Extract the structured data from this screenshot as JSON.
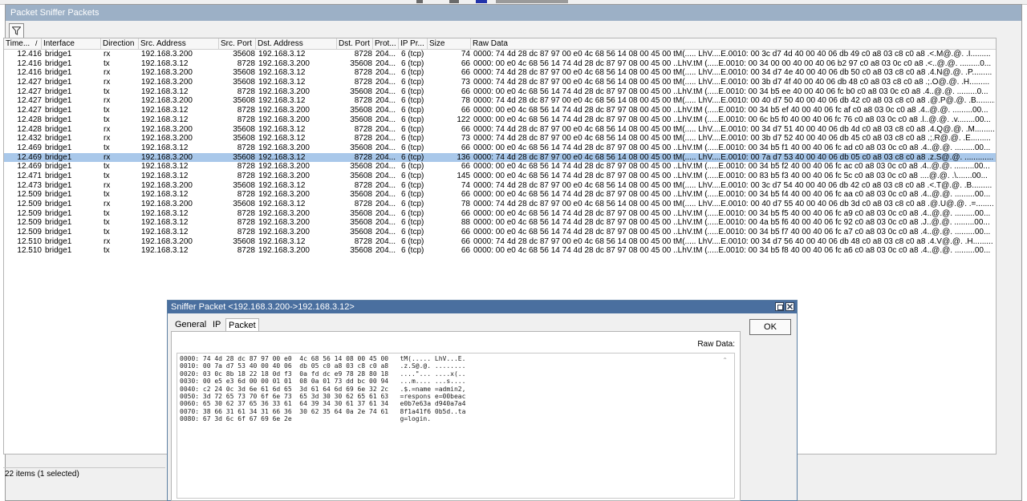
{
  "window": {
    "title": "Packet Sniffer Packets"
  },
  "toolbar": {
    "filter_icon": "funnel-icon"
  },
  "columns": [
    "Time...",
    "/",
    "Interface",
    "Direction",
    "Src. Address",
    "Src. Port",
    "Dst. Address",
    "Dst. Port",
    "Prot...",
    "IP Pr...",
    "Size",
    "Raw Data"
  ],
  "rows": [
    [
      "12.416",
      "bridge1",
      "rx",
      "192.168.3.200",
      "35608",
      "192.168.3.12",
      "8728",
      "204...",
      "6 (tcp)",
      "74",
      "0000: 74 4d 28 dc 87 97 00 e0  4c 68 56 14 08 00 45 00  tM(..... LhV....E.0010: 00 3c d7 4d 40 00 40 06  db 49 c0 a8 03 c8 c0 a8  .<.M@.@. .I.........",
      false
    ],
    [
      "12.416",
      "bridge1",
      "tx",
      "192.168.3.12",
      "8728",
      "192.168.3.200",
      "35608",
      "204...",
      "6 (tcp)",
      "66",
      "0000: 00 e0 4c 68 56 14 74 4d  28 dc 87 97 08 00 45 00  ..LhV.tM (.....E.0010: 00 34 00 00 40 00 40 06  b2 97 c0 a8 03 0c c0 a8  .<..@.@. .........0...",
      false
    ],
    [
      "12.416",
      "bridge1",
      "rx",
      "192.168.3.200",
      "35608",
      "192.168.3.12",
      "8728",
      "204...",
      "6 (tcp)",
      "66",
      "0000: 74 4d 28 dc 87 97 00 e0  4c 68 56 14 08 00 45 00  tM(..... LhV....E.0010: 00 34 d7 4e 40 00 40 06  db 50 c0 a8 03 c8 c0 a8  .4.N@.@. .P.........",
      false
    ],
    [
      "12.427",
      "bridge1",
      "rx",
      "192.168.3.200",
      "35608",
      "192.168.3.12",
      "8728",
      "204...",
      "6 (tcp)",
      "73",
      "0000: 74 4d 28 dc 87 97 00 e0  4c 68 56 14 08 00 45 00  tM(..... LhV....E.0010: 00 3b d7 4f 40 00 40 06  db 48 c0 a8 03 c8 c0 a8  .;.O@.@. .H.........",
      false
    ],
    [
      "12.427",
      "bridge1",
      "tx",
      "192.168.3.12",
      "8728",
      "192.168.3.200",
      "35608",
      "204...",
      "6 (tcp)",
      "66",
      "0000: 00 e0 4c 68 56 14 74 4d  28 dc 87 97 08 00 45 00  ..LhV.tM (.....E.0010: 00 34 b5 ee 40 00 40 06  fc b0 c0 a8 03 0c c0 a8  .4..@.@. .........0...",
      false
    ],
    [
      "12.427",
      "bridge1",
      "rx",
      "192.168.3.200",
      "35608",
      "192.168.3.12",
      "8728",
      "204...",
      "6 (tcp)",
      "78",
      "0000: 74 4d 28 dc 87 97 00 e0  4c 68 56 14 08 00 45 00  tM(..... LhV....E.0010: 00 40 d7 50 40 00 40 06  db 42 c0 a8 03 c8 c0 a8  .@.P@.@. .B.........",
      false
    ],
    [
      "12.427",
      "bridge1",
      "tx",
      "192.168.3.12",
      "8728",
      "192.168.3.200",
      "35608",
      "204...",
      "6 (tcp)",
      "66",
      "0000: 00 e0 4c 68 56 14 74 4d  28 dc 87 97 08 00 45 00  ..LhV.tM (.....E.0010: 00 34 b5 ef 40 00 40 06  fc af c0 a8 03 0c c0 a8  .4..@.@. .........00...",
      false
    ],
    [
      "12.428",
      "bridge1",
      "tx",
      "192.168.3.12",
      "8728",
      "192.168.3.200",
      "35608",
      "204...",
      "6 (tcp)",
      "122",
      "0000: 00 e0 4c 68 56 14 74 4d  28 dc 87 97 08 00 45 00  ..LhV.tM (.....E.0010: 00 6c b5 f0 40 00 40 06  fc 76 c0 a8 03 0c c0 a8  .l..@.@. .v........00...",
      false
    ],
    [
      "12.428",
      "bridge1",
      "rx",
      "192.168.3.200",
      "35608",
      "192.168.3.12",
      "8728",
      "204...",
      "6 (tcp)",
      "66",
      "0000: 74 4d 28 dc 87 97 00 e0  4c 68 56 14 08 00 45 00  tM(..... LhV....E.0010: 00 34 d7 51 40 00 40 06  db 4d c0 a8 03 c8 c0 a8  .4.Q@.@. .M.........",
      false
    ],
    [
      "12.432",
      "bridge1",
      "rx",
      "192.168.3.200",
      "35608",
      "192.168.3.12",
      "8728",
      "204...",
      "6 (tcp)",
      "73",
      "0000: 74 4d 28 dc 87 97 00 e0  4c 68 56 14 08 00 45 00  tM(..... LhV....E.0010: 00 3b d7 52 40 00 40 06  db 45 c0 a8 03 c8 c0 a8  .;.R@.@. .E.........",
      false
    ],
    [
      "12.469",
      "bridge1",
      "tx",
      "192.168.3.12",
      "8728",
      "192.168.3.200",
      "35608",
      "204...",
      "6 (tcp)",
      "66",
      "0000: 00 e0 4c 68 56 14 74 4d  28 dc 87 97 08 00 45 00  ..LhV.tM (.....E.0010: 00 34 b5 f1 40 00 40 06  fc ad c0 a8 03 0c c0 a8  .4..@.@. .........00...",
      false
    ],
    [
      "12.469",
      "bridge1",
      "rx",
      "192.168.3.200",
      "35608",
      "192.168.3.12",
      "8728",
      "204...",
      "6 (tcp)",
      "136",
      "0000: 74 4d 28 dc 87 97 00 e0  4c 68 56 14 08 00 45 00  tM(..... LhV....E.0010: 00 7a d7 53 40 00 40 06  db 05 c0 a8 03 c8 c0 a8  .z.S@.@. .............",
      true
    ],
    [
      "12.469",
      "bridge1",
      "tx",
      "192.168.3.12",
      "8728",
      "192.168.3.200",
      "35608",
      "204...",
      "6 (tcp)",
      "66",
      "0000: 00 e0 4c 68 56 14 74 4d  28 dc 87 97 08 00 45 00  ..LhV.tM (.....E.0010: 00 34 b5 f2 40 00 40 06  fc ac c0 a8 03 0c c0 a8  .4..@.@. .........00...",
      false
    ],
    [
      "12.471",
      "bridge1",
      "tx",
      "192.168.3.12",
      "8728",
      "192.168.3.200",
      "35608",
      "204...",
      "6 (tcp)",
      "145",
      "0000: 00 e0 4c 68 56 14 74 4d  28 dc 87 97 08 00 45 00  ..LhV.tM (.....E.0010: 00 83 b5 f3 40 00 40 06  fc 5c c0 a8 03 0c c0 a8  ....@.@. .\\.......00...",
      false
    ],
    [
      "12.473",
      "bridge1",
      "rx",
      "192.168.3.200",
      "35608",
      "192.168.3.12",
      "8728",
      "204...",
      "6 (tcp)",
      "74",
      "0000: 74 4d 28 dc 87 97 00 e0  4c 68 56 14 08 00 45 00  tM(..... LhV....E.0010: 00 3c d7 54 40 00 40 06  db 42 c0 a8 03 c8 c0 a8  .<.T@.@. .B.........",
      false
    ],
    [
      "12.509",
      "bridge1",
      "tx",
      "192.168.3.12",
      "8728",
      "192.168.3.200",
      "35608",
      "204...",
      "6 (tcp)",
      "66",
      "0000: 00 e0 4c 68 56 14 74 4d  28 dc 87 97 08 00 45 00  ..LhV.tM (.....E.0010: 00 34 b5 f4 40 00 40 06  fc aa c0 a8 03 0c c0 a8  .4..@.@. .........00...",
      false
    ],
    [
      "12.509",
      "bridge1",
      "rx",
      "192.168.3.200",
      "35608",
      "192.168.3.12",
      "8728",
      "204...",
      "6 (tcp)",
      "78",
      "0000: 74 4d 28 dc 87 97 00 e0  4c 68 56 14 08 00 45 00  tM(..... LhV....E.0010: 00 40 d7 55 40 00 40 06  db 3d c0 a8 03 c8 c0 a8  .@.U@.@. .=........",
      false
    ],
    [
      "12.509",
      "bridge1",
      "tx",
      "192.168.3.12",
      "8728",
      "192.168.3.200",
      "35608",
      "204...",
      "6 (tcp)",
      "66",
      "0000: 00 e0 4c 68 56 14 74 4d  28 dc 87 97 08 00 45 00  ..LhV.tM (.....E.0010: 00 34 b5 f5 40 00 40 06  fc a9 c0 a8 03 0c c0 a8  .4..@.@. .........00...",
      false
    ],
    [
      "12.509",
      "bridge1",
      "tx",
      "192.168.3.12",
      "8728",
      "192.168.3.200",
      "35608",
      "204...",
      "6 (tcp)",
      "88",
      "0000: 00 e0 4c 68 56 14 74 4d  28 dc 87 97 08 00 45 00  ..LhV.tM (.....E.0010: 00 4a b5 f6 40 00 40 06  fc 92 c0 a8 03 0c c0 a8  .J..@.@. .........00...",
      false
    ],
    [
      "12.509",
      "bridge1",
      "tx",
      "192.168.3.12",
      "8728",
      "192.168.3.200",
      "35608",
      "204...",
      "6 (tcp)",
      "66",
      "0000: 00 e0 4c 68 56 14 74 4d  28 dc 87 97 08 00 45 00  ..LhV.tM (.....E.0010: 00 34 b5 f7 40 00 40 06  fc a7 c0 a8 03 0c c0 a8  .4..@.@. .........00...",
      false
    ],
    [
      "12.510",
      "bridge1",
      "rx",
      "192.168.3.200",
      "35608",
      "192.168.3.12",
      "8728",
      "204...",
      "6 (tcp)",
      "66",
      "0000: 74 4d 28 dc 87 97 00 e0  4c 68 56 14 08 00 45 00  tM(..... LhV....E.0010: 00 34 d7 56 40 00 40 06  db 48 c0 a8 03 c8 c0 a8  .4.V@.@. .H.........",
      false
    ],
    [
      "12.510",
      "bridge1",
      "tx",
      "192.168.3.12",
      "8728",
      "192.168.3.200",
      "35608",
      "204...",
      "6 (tcp)",
      "66",
      "0000: 00 e0 4c 68 56 14 74 4d  28 dc 87 97 08 00 45 00  ..LhV.tM (.....E.0010: 00 34 b5 f8 40 00 40 06  fc a6 c0 a8 03 0c c0 a8  .4..@.@. .........00...",
      false
    ]
  ],
  "status": "22 items (1 selected)",
  "dialog": {
    "title": "Sniffer Packet <192.168.3.200->192.168.3.12>",
    "tabs": [
      "General",
      "IP",
      "Packet"
    ],
    "ok_label": "OK",
    "raw_label": "Raw Data:",
    "raw_lines": [
      "0000: 74 4d 28 dc 87 97 00 e0  4c 68 56 14 08 00 45 00   tM(..... LhV...E.",
      "0010: 00 7a d7 53 40 00 40 06  db 05 c0 a8 03 c8 c0 a8   .z.S@.@. ........",
      "0020: 03 0c 8b 18 22 18 0d f3  0a fd dc e9 78 28 80 18   ....\"... ....x(..",
      "0030: 00 e5 e3 6d 00 00 01 01  08 0a 01 73 dd bc 00 94   ...m.... ...s....",
      "0040: c2 24 0c 3d 6e 61 6d 65  3d 61 64 6d 69 6e 32 2c   .$.=name =admin2,",
      "0050: 3d 72 65 73 70 6f 6e 73  65 3d 30 30 62 65 61 63   =respons e=00beac",
      "0060: 65 30 62 37 65 36 33 61  64 39 34 30 61 37 61 34   e0b7e63a d940a7a4",
      "0070: 38 66 31 61 34 31 66 36  30 62 35 64 0a 2e 74 61   8f1a41f6 0b5d..ta",
      "0080: 67 3d 6c 6f 67 69 6e 2e                            g=login."
    ]
  }
}
